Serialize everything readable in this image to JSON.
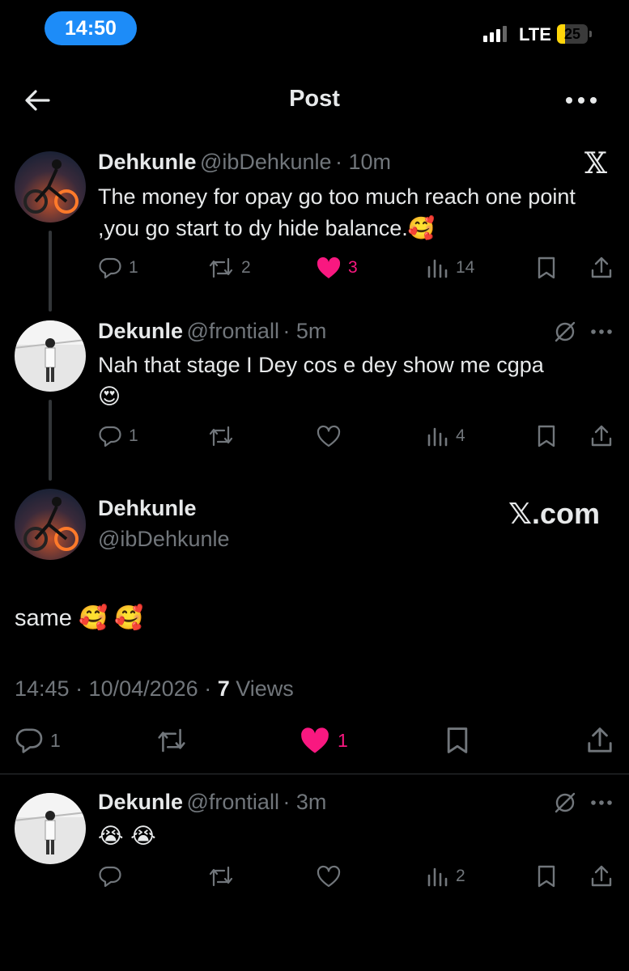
{
  "status_bar": {
    "time": "14:50",
    "network": "LTE",
    "battery": "25",
    "battery_level": 0.25
  },
  "header": {
    "title": "Post"
  },
  "tweets": [
    {
      "name": "Dehkunle",
      "handle": "@ibDehkunle",
      "time": "· 10m",
      "text": "The money for opay go too much reach one point ,you go start to dy hide balance.🥰",
      "replies": "1",
      "reposts": "2",
      "likes": "3",
      "views": "14"
    },
    {
      "name": "Dekunle",
      "handle": "@frontiall",
      "time": "· 5m",
      "text_line1": "Nah that stage I Dey cos e dey show me cgpa",
      "text_line2": "😍",
      "replies": "1",
      "reposts": "",
      "likes": "",
      "views": "4"
    }
  ],
  "main_post": {
    "name": "Dehkunle",
    "handle": "@ibDehkunle",
    "brand": "𝕏.com",
    "text": "same 🥰 🥰",
    "timestamp": "14:45 · 10/04/2026 · ",
    "views_count": "7",
    "views_label": " Views",
    "replies": "1",
    "likes": "1"
  },
  "reply": {
    "name": "Dekunle",
    "handle": "@frontiall",
    "time": "· 3m",
    "text": "😭 😭",
    "views": "2"
  },
  "icons": {
    "x_logo": "𝕏",
    "accent_like": "#f91880",
    "accent_time_pill": "#1d8cf8"
  }
}
